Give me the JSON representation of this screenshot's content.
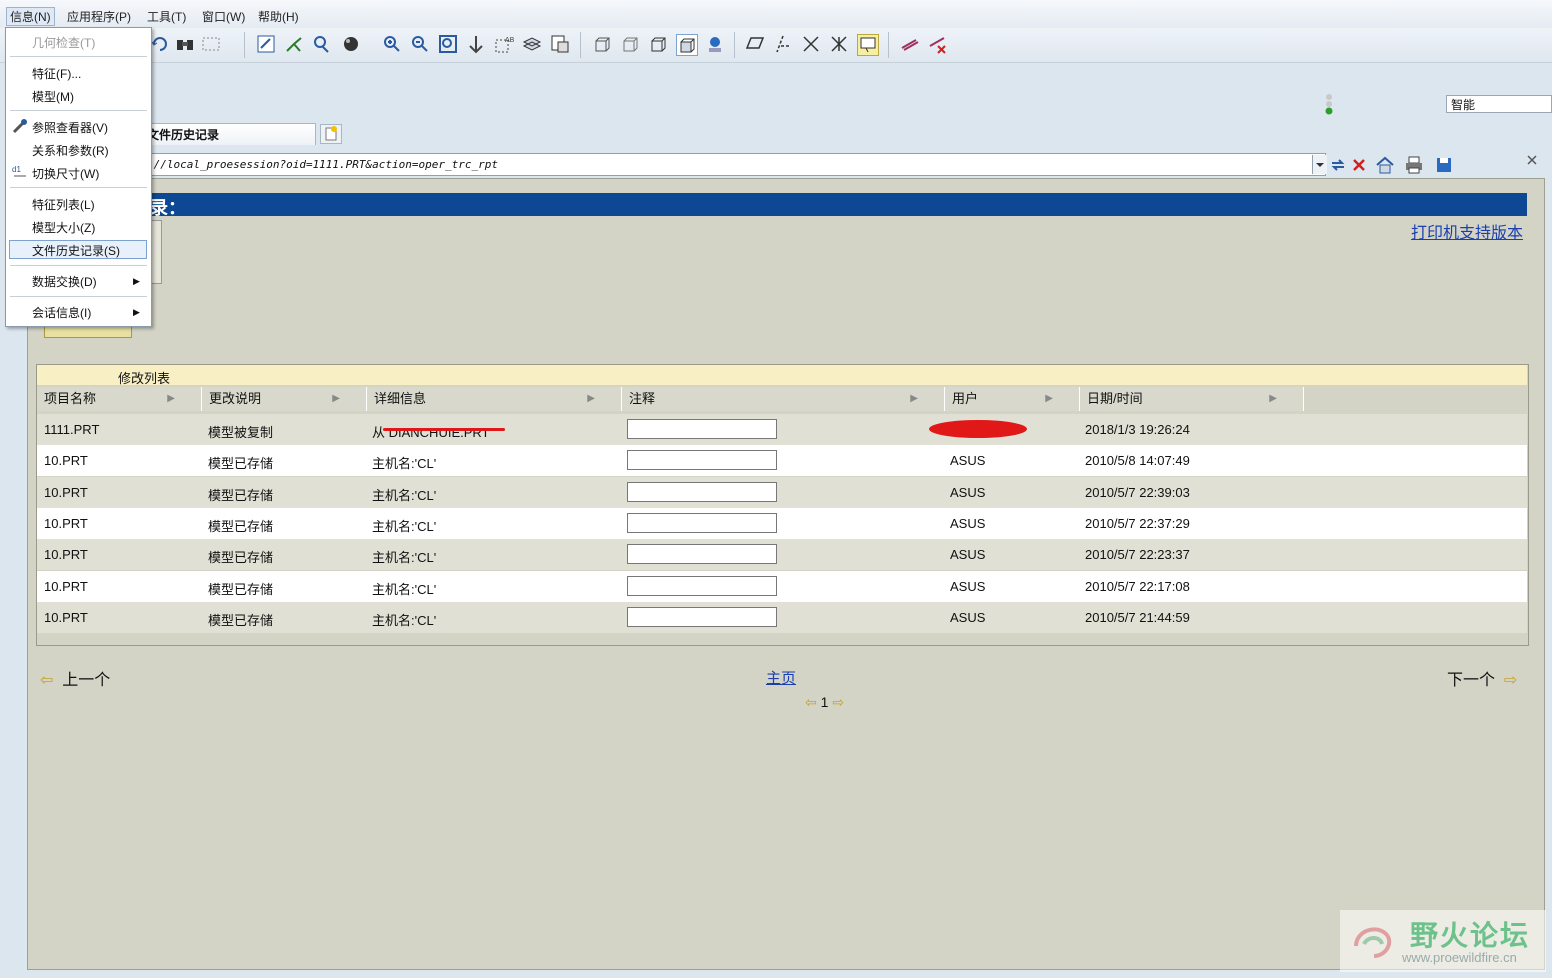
{
  "menubar": {
    "items": [
      "信息(N)",
      "应用程序(P)",
      "工具(T)",
      "窗口(W)",
      "帮助(H)"
    ]
  },
  "toolbar": {
    "smart_filter": "智能"
  },
  "tab": {
    "label": "文件历史记录"
  },
  "address": {
    "url": "://local_proesession?oid=1111.PRT&action=oper_trc_rpt"
  },
  "page": {
    "title_fragment": "录：",
    "print_link": "打印机支持版本"
  },
  "dropdown": {
    "items": [
      {
        "label": "几何检查(T)",
        "disabled": true
      },
      {
        "label": "特征(F)..."
      },
      {
        "label": "模型(M)"
      },
      {
        "label": "参照查看器(V)"
      },
      {
        "label": "关系和参数(R)"
      },
      {
        "label": "切换尺寸(W)"
      },
      {
        "label": "特征列表(L)"
      },
      {
        "label": "模型大小(Z)"
      },
      {
        "label": "文件历史记录(S)",
        "selected": true
      },
      {
        "label": "数据交换(D)"
      },
      {
        "label": "会话信息(I)"
      }
    ]
  },
  "table": {
    "caption": "修改列表",
    "columns": [
      "项目名称",
      "更改说明",
      "详细信息",
      "注释",
      "用户",
      "日期/时间"
    ],
    "rows": [
      {
        "item": "1111.PRT",
        "change": "模型被复制",
        "detail": "从 DIANCHUIE.PRT",
        "user": "",
        "datetime": "2018/1/3 19:26:24"
      },
      {
        "item": "10.PRT",
        "change": "模型已存储",
        "detail": "主机名:'CL'",
        "user": "ASUS",
        "datetime": "2010/5/8 14:07:49"
      },
      {
        "item": "10.PRT",
        "change": "模型已存储",
        "detail": "主机名:'CL'",
        "user": "ASUS",
        "datetime": "2010/5/7 22:39:03"
      },
      {
        "item": "10.PRT",
        "change": "模型已存储",
        "detail": "主机名:'CL'",
        "user": "ASUS",
        "datetime": "2010/5/7 22:37:29"
      },
      {
        "item": "10.PRT",
        "change": "模型已存储",
        "detail": "主机名:'CL'",
        "user": "ASUS",
        "datetime": "2010/5/7 22:23:37"
      },
      {
        "item": "10.PRT",
        "change": "模型已存储",
        "detail": "主机名:'CL'",
        "user": "ASUS",
        "datetime": "2010/5/7 22:17:08"
      },
      {
        "item": "10.PRT",
        "change": "模型已存储",
        "detail": "主机名:'CL'",
        "user": "ASUS",
        "datetime": "2010/5/7 21:44:59"
      }
    ]
  },
  "nav": {
    "prev": "上一个",
    "home": "主页",
    "next": "下一个",
    "page": "1"
  },
  "watermark": {
    "title": "野火论坛",
    "url": "www.proewildfire.cn"
  },
  "colors": {
    "title_bar": "#0e4794",
    "link": "#1a3fb0",
    "content_bg": "#d4d4c6"
  }
}
